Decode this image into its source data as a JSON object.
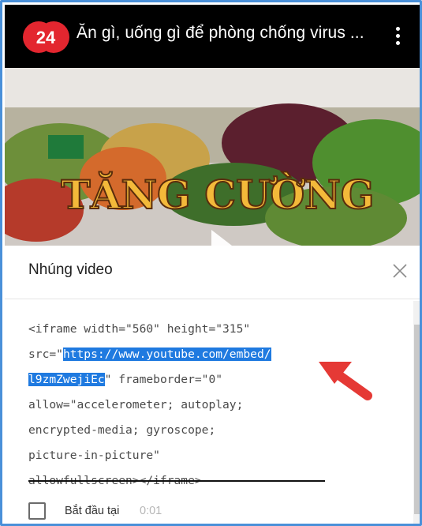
{
  "video": {
    "channel_logo_text": "24",
    "title": "Ăn gì, uống gì để phòng chống virus ...",
    "thumbnail_headline": "TĂNG CƯỜNG",
    "more_icon": "kebab-menu-icon"
  },
  "dialog": {
    "title": "Nhúng video",
    "close_icon": "close-icon",
    "code_lines": [
      {
        "before": "<iframe width=\"560\" height=\"315\"",
        "hl": "",
        "after": ""
      },
      {
        "before": "src=\"",
        "hl": "https://www.youtube.com/embed/",
        "after": ""
      },
      {
        "before": "",
        "hl": "l9zmZwejiEc",
        "after": "\" frameborder=\"0\""
      },
      {
        "before": "allow=\"accelerometer; autoplay;",
        "hl": "",
        "after": ""
      },
      {
        "before": "encrypted-media; gyroscope;",
        "hl": "",
        "after": ""
      },
      {
        "before": "picture-in-picture\"",
        "hl": "",
        "after": ""
      },
      {
        "before": "allowfullscreen></iframe>",
        "hl": "",
        "after": ""
      }
    ],
    "start_at_label": "Bắt đầu tại",
    "start_at_time": "0:01"
  },
  "colors": {
    "frame_border": "#4a90d9",
    "logo_red": "#e3262f",
    "selection": "#1f7ae0",
    "arrow": "#e53935"
  }
}
